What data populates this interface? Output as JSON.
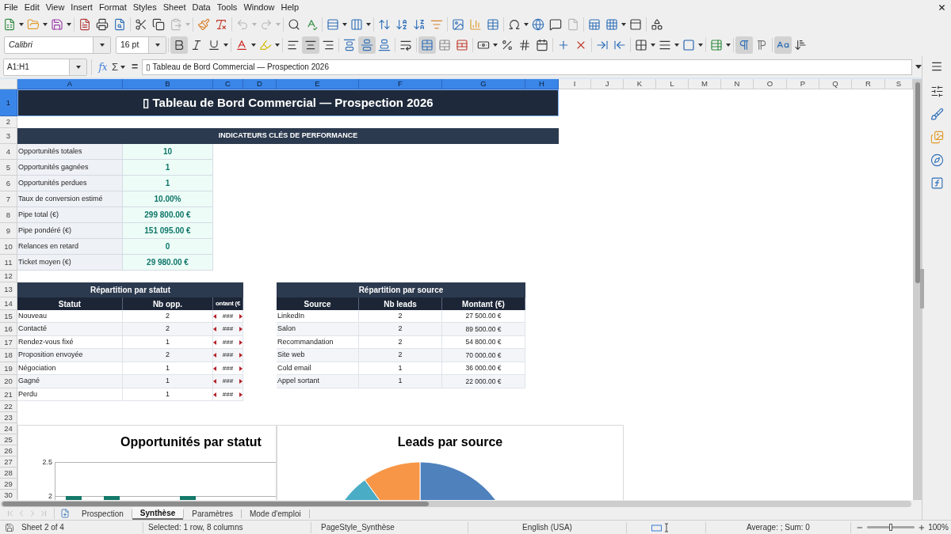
{
  "menu_bar": [
    "File",
    "Edit",
    "View",
    "Insert",
    "Format",
    "Styles",
    "Sheet",
    "Data",
    "Tools",
    "Window",
    "Help"
  ],
  "standard_toolbar": {
    "groups": [
      {
        "buttons": [
          {
            "kind": "new",
            "dropdown": true,
            "disabled": false
          },
          {
            "kind": "open",
            "dropdown": true,
            "disabled": false
          },
          {
            "kind": "save",
            "dropdown": true,
            "disabled": false
          }
        ]
      },
      {
        "buttons": [
          {
            "kind": "export_pdf",
            "dropdown": false,
            "disabled": false
          },
          {
            "kind": "print",
            "dropdown": false,
            "disabled": false
          },
          {
            "kind": "print_preview",
            "dropdown": false,
            "disabled": false
          }
        ]
      },
      {
        "buttons": [
          {
            "kind": "cut",
            "dropdown": false,
            "disabled": false
          },
          {
            "kind": "copy",
            "dropdown": false,
            "disabled": false
          },
          {
            "kind": "paste",
            "dropdown": true,
            "disabled": true
          }
        ]
      },
      {
        "buttons": [
          {
            "kind": "clone_format",
            "dropdown": false,
            "disabled": false
          },
          {
            "kind": "clear_format",
            "dropdown": false,
            "disabled": false
          }
        ]
      },
      {
        "buttons": [
          {
            "kind": "undo",
            "dropdown": true,
            "disabled": true
          },
          {
            "kind": "redo",
            "dropdown": true,
            "disabled": true
          }
        ]
      },
      {
        "buttons": [
          {
            "kind": "find_replace",
            "dropdown": false,
            "disabled": false
          },
          {
            "kind": "spelling",
            "dropdown": false,
            "disabled": false
          }
        ]
      },
      {
        "buttons": [
          {
            "kind": "rows",
            "dropdown": true,
            "disabled": false
          },
          {
            "kind": "columns",
            "dropdown": true,
            "disabled": false
          }
        ]
      },
      {
        "buttons": [
          {
            "kind": "sort",
            "dropdown": false,
            "disabled": false
          },
          {
            "kind": "sort_ascending",
            "dropdown": false,
            "disabled": false
          },
          {
            "kind": "sort_descending",
            "dropdown": false,
            "disabled": false
          },
          {
            "kind": "autofilter",
            "dropdown": false,
            "disabled": false
          }
        ]
      },
      {
        "buttons": [
          {
            "kind": "image",
            "dropdown": false,
            "disabled": false
          },
          {
            "kind": "chart",
            "dropdown": false,
            "disabled": false
          },
          {
            "kind": "pivot_table",
            "dropdown": false,
            "disabled": false
          }
        ]
      },
      {
        "buttons": [
          {
            "kind": "special_character",
            "dropdown": true,
            "disabled": false
          },
          {
            "kind": "hyperlink",
            "dropdown": false,
            "disabled": false
          },
          {
            "kind": "comment",
            "dropdown": false,
            "disabled": false
          },
          {
            "kind": "header_footer",
            "dropdown": false,
            "disabled": true
          }
        ]
      },
      {
        "buttons": [
          {
            "kind": "print_area",
            "dropdown": false,
            "disabled": false
          },
          {
            "kind": "freeze",
            "dropdown": true,
            "disabled": false
          },
          {
            "kind": "split_window",
            "dropdown": false,
            "disabled": false
          }
        ]
      },
      {
        "buttons": [
          {
            "kind": "shapes",
            "dropdown": false,
            "disabled": false
          }
        ]
      }
    ]
  },
  "formatting_toolbar": {
    "font_name": "Calibri",
    "font_size": "16 pt",
    "groups": [
      {
        "buttons": [
          {
            "kind": "bold",
            "dropdown": false,
            "pressed": true
          },
          {
            "kind": "italic",
            "dropdown": false,
            "pressed": false
          },
          {
            "kind": "underline",
            "dropdown": true,
            "pressed": false
          }
        ]
      },
      {
        "buttons": [
          {
            "kind": "font_color",
            "dropdown": true,
            "pressed": false
          },
          {
            "kind": "highlight",
            "dropdown": true,
            "pressed": false
          }
        ]
      },
      {
        "buttons": [
          {
            "kind": "align_left",
            "dropdown": false,
            "pressed": false
          },
          {
            "kind": "align_center",
            "dropdown": false,
            "pressed": true
          },
          {
            "kind": "align_right",
            "dropdown": false,
            "pressed": false
          }
        ]
      },
      {
        "buttons": [
          {
            "kind": "align_top",
            "dropdown": false,
            "pressed": false
          },
          {
            "kind": "align_middle",
            "dropdown": false,
            "pressed": true
          },
          {
            "kind": "align_bottom",
            "dropdown": false,
            "pressed": false
          }
        ]
      },
      {
        "buttons": [
          {
            "kind": "wrap_text",
            "dropdown": false,
            "pressed": false
          }
        ]
      },
      {
        "buttons": [
          {
            "kind": "merge_center",
            "dropdown": false,
            "pressed": true
          },
          {
            "kind": "merge_cells",
            "dropdown": false,
            "pressed": false
          },
          {
            "kind": "unmerge_cells",
            "dropdown": false,
            "pressed": false
          }
        ]
      },
      {
        "buttons": [
          {
            "kind": "currency",
            "dropdown": true,
            "pressed": false
          },
          {
            "kind": "percent",
            "dropdown": false,
            "pressed": false
          },
          {
            "kind": "number_standard",
            "dropdown": false,
            "pressed": false
          },
          {
            "kind": "date",
            "dropdown": false,
            "pressed": false
          }
        ]
      },
      {
        "buttons": [
          {
            "kind": "add_decimal",
            "dropdown": false,
            "pressed": false
          },
          {
            "kind": "delete_decimal",
            "dropdown": false,
            "pressed": false
          }
        ]
      },
      {
        "buttons": [
          {
            "kind": "indent_increase",
            "dropdown": false,
            "pressed": false
          },
          {
            "kind": "indent_decrease",
            "dropdown": false,
            "pressed": false
          }
        ]
      },
      {
        "buttons": [
          {
            "kind": "borders",
            "dropdown": true,
            "pressed": false
          },
          {
            "kind": "border_style",
            "dropdown": true,
            "pressed": false
          },
          {
            "kind": "border_color",
            "dropdown": true,
            "pressed": false
          }
        ]
      },
      {
        "buttons": [
          {
            "kind": "conditional",
            "dropdown": true,
            "pressed": false
          }
        ]
      },
      {
        "buttons": [
          {
            "kind": "left_to_right",
            "dropdown": false,
            "pressed": true
          },
          {
            "kind": "right_to_left",
            "dropdown": false,
            "pressed": false
          }
        ]
      },
      {
        "buttons": [
          {
            "kind": "text_horizontal",
            "dropdown": false,
            "pressed": true
          },
          {
            "kind": "text_vertical",
            "dropdown": false,
            "pressed": false
          }
        ]
      }
    ]
  },
  "formula_bar": {
    "name_box": "A1:H1",
    "function_wizard": "fx",
    "sum": "Σ",
    "equals": "=",
    "content": "▯ Tableau de Bord Commercial — Prospection 2026"
  },
  "sheet": {
    "column_headers": [
      {
        "label": "A",
        "selected": true
      },
      {
        "label": "B",
        "selected": true
      },
      {
        "label": "C",
        "selected": true
      },
      {
        "label": "D",
        "selected": true
      },
      {
        "label": "E",
        "selected": true
      },
      {
        "label": "F",
        "selected": true
      },
      {
        "label": "G",
        "selected": true
      },
      {
        "label": "H",
        "selected": true
      },
      {
        "label": "I",
        "selected": false
      },
      {
        "label": "J",
        "selected": false
      },
      {
        "label": "K",
        "selected": false
      },
      {
        "label": "L",
        "selected": false
      },
      {
        "label": "M",
        "selected": false
      },
      {
        "label": "N",
        "selected": false
      },
      {
        "label": "O",
        "selected": false
      },
      {
        "label": "P",
        "selected": false
      },
      {
        "label": "Q",
        "selected": false
      },
      {
        "label": "R",
        "selected": false
      },
      {
        "label": "S",
        "selected": false
      }
    ],
    "row_headers": [
      {
        "label": "1",
        "selected": true
      },
      {
        "label": "2",
        "selected": false
      },
      {
        "label": "3",
        "selected": false
      },
      {
        "label": "4",
        "selected": false
      },
      {
        "label": "5",
        "selected": false
      },
      {
        "label": "6",
        "selected": false
      },
      {
        "label": "7",
        "selected": false
      },
      {
        "label": "8",
        "selected": false
      },
      {
        "label": "9",
        "selected": false
      },
      {
        "label": "10",
        "selected": false
      },
      {
        "label": "11",
        "selected": false
      },
      {
        "label": "12",
        "selected": false
      },
      {
        "label": "13",
        "selected": false
      },
      {
        "label": "14",
        "selected": false
      },
      {
        "label": "15",
        "selected": false
      },
      {
        "label": "16",
        "selected": false
      },
      {
        "label": "17",
        "selected": false
      },
      {
        "label": "18",
        "selected": false
      },
      {
        "label": "19",
        "selected": false
      },
      {
        "label": "20",
        "selected": false
      },
      {
        "label": "21",
        "selected": false
      },
      {
        "label": "22",
        "selected": false
      },
      {
        "label": "23",
        "selected": false
      },
      {
        "label": "24",
        "selected": false
      },
      {
        "label": "25",
        "selected": false
      },
      {
        "label": "26",
        "selected": false
      },
      {
        "label": "27",
        "selected": false
      },
      {
        "label": "28",
        "selected": false
      },
      {
        "label": "29",
        "selected": false
      },
      {
        "label": "30",
        "selected": false
      }
    ],
    "title": "▯ Tableau de Bord Commercial — Prospection 2026",
    "kpi_header": "INDICATEURS CLÉS DE PERFORMANCE",
    "kpis": [
      {
        "label": "Opportunités totales",
        "value": "10"
      },
      {
        "label": "Opportunités gagnées",
        "value": "1"
      },
      {
        "label": "Opportunités perdues",
        "value": "1"
      },
      {
        "label": "Taux de conversion estimé",
        "value": "10.00%"
      },
      {
        "label": "Pipe total (€)",
        "value": "299 800.00 €"
      },
      {
        "label": "Pipe pondéré (€)",
        "value": "151 095.00 €"
      },
      {
        "label": "Relances en retard",
        "value": "0"
      },
      {
        "label": "Ticket moyen (€)",
        "value": "29 980.00 €"
      }
    ],
    "status_table": {
      "title": "Répartition par statut",
      "columns": [
        "Statut",
        "Nb opp.",
        "ontant (€"
      ],
      "rows": [
        {
          "cells": [
            "Nouveau",
            "2",
            "###"
          ],
          "overflow": true
        },
        {
          "cells": [
            "Contacté",
            "2",
            "###"
          ],
          "overflow": true
        },
        {
          "cells": [
            "Rendez-vous fixé",
            "1",
            "###"
          ],
          "overflow": true
        },
        {
          "cells": [
            "Proposition envoyée",
            "2",
            "###"
          ],
          "overflow": true
        },
        {
          "cells": [
            "Négociation",
            "1",
            "###"
          ],
          "overflow": true
        },
        {
          "cells": [
            "Gagné",
            "1",
            "###"
          ],
          "overflow": true
        },
        {
          "cells": [
            "Perdu",
            "1",
            "###"
          ],
          "overflow": true
        }
      ]
    },
    "source_table": {
      "title": "Répartition par source",
      "columns": [
        "Source",
        "Nb leads",
        "Montant (€)"
      ],
      "rows": [
        {
          "cells": [
            "LinkedIn",
            "2",
            "27 500.00 €"
          ]
        },
        {
          "cells": [
            "Salon",
            "2",
            "89 500.00 €"
          ]
        },
        {
          "cells": [
            "Recommandation",
            "2",
            "54 800.00 €"
          ]
        },
        {
          "cells": [
            "Site web",
            "2",
            "70 000.00 €"
          ]
        },
        {
          "cells": [
            "Cold email",
            "1",
            "36 000.00 €"
          ]
        },
        {
          "cells": [
            "Appel sortant",
            "1",
            "22 000.00 €"
          ]
        }
      ]
    },
    "charts": [
      {
        "kind": "bar",
        "title": "Opportunités par statut",
        "y_tick_labels": [
          "2.5",
          "2"
        ]
      },
      {
        "kind": "pie",
        "title": "Leads par source"
      }
    ]
  },
  "sheet_navigation": [
    {
      "kind": "first",
      "disabled": true
    },
    {
      "kind": "previous",
      "disabled": true
    },
    {
      "kind": "next",
      "disabled": true
    },
    {
      "kind": "last",
      "disabled": true
    }
  ],
  "sheet_tabs": [
    {
      "label": "Prospection",
      "selected": false
    },
    {
      "label": "Synthèse",
      "selected": true
    },
    {
      "label": "Paramètres",
      "selected": false
    },
    {
      "label": "Mode d'emploi",
      "selected": false
    }
  ],
  "status_bar": {
    "sheet_info": "Sheet 2 of 4",
    "selection": "Selected: 1 row, 8 columns",
    "page_style": "PageStyle_Synthèse",
    "language": "English (USA)",
    "summary": "Average: ; Sum: 0",
    "zoom": {
      "level": 0.5,
      "reading": "100%"
    }
  }
}
